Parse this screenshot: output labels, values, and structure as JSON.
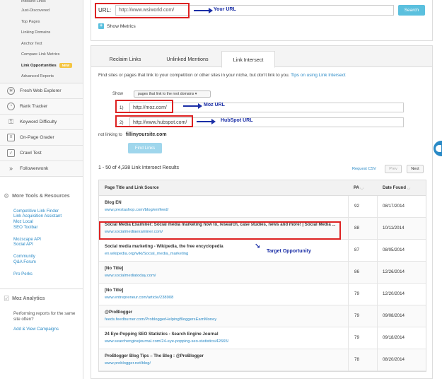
{
  "sidebar": {
    "subnav": [
      {
        "label": "Inbound Links"
      },
      {
        "label": "Just-Discovered"
      },
      {
        "label": "Top Pages"
      },
      {
        "label": "Linking Domains"
      },
      {
        "label": "Anchor Text"
      },
      {
        "label": "Compare Link Metrics"
      },
      {
        "label": "Link Opportunities",
        "badge": "NEW"
      },
      {
        "label": "Advanced Reports"
      }
    ],
    "tools": [
      {
        "label": "Fresh Web Explorer",
        "icon": "compass-icon"
      },
      {
        "label": "Rank Tracker",
        "icon": "gauge-icon"
      },
      {
        "label": "Keyword Difficulty",
        "icon": "key-icon"
      },
      {
        "label": "On-Page Grader",
        "icon": "document-icon"
      },
      {
        "label": "Crawl Test",
        "icon": "checkbox-icon"
      },
      {
        "label": "Followerwonk",
        "icon": "chevrons-icon"
      }
    ],
    "more_tools_title": "More Tools & Resources",
    "more_tools_links": [
      "Competitive Link Finder",
      "Link Acquisition Assistant",
      "Moz Local",
      "SEO Toolbar"
    ],
    "api_links": [
      "Mozscape API",
      "Social API"
    ],
    "community_links": [
      "Community",
      "Q&A Forum"
    ],
    "perks_link": "Pro Perks",
    "analytics_title": "Moz Analytics",
    "analytics_text": "Performing reports for the same site often?",
    "analytics_link": "Add & View Campaigns"
  },
  "header": {
    "url_label": "URL:",
    "url_value": "http://www.wsiworld.com/",
    "search_label": "Search",
    "show_metrics": "Show Metrics"
  },
  "tabs": [
    {
      "label": "Reclaim Links"
    },
    {
      "label": "Unlinked Mentions"
    },
    {
      "label": "Link Intersect"
    }
  ],
  "intersect": {
    "description": "Find sites or pages that link to your competition or other sites in your niche, but don't link to you.",
    "tip": "Tips on using Link Intersect",
    "show_label": "Show",
    "show_select": "pages that link to the root domains",
    "domains": [
      {
        "num": "1)",
        "value": "http://moz.com/"
      },
      {
        "num": "2)",
        "value": "http://www.hubspot.com/"
      }
    ],
    "not_linking_label": "not linking to",
    "not_linking_value": "fillinyoursite.com",
    "find_button": "Find Links",
    "results_count": "1 - 50 of 4,338 Link Intersect Results",
    "request_csv": "Request CSV",
    "prev": "Prev",
    "next": "Next"
  },
  "table": {
    "headers": {
      "title": "Page Title and Link Source",
      "pa": "PA",
      "date": "Date Found"
    },
    "rows": [
      {
        "title": "Blog EN",
        "url": "www.prestashop.com/blog/en/feed/",
        "pa": "92",
        "date": "08/17/2014"
      },
      {
        "title": "Social Media Examiner: Social media marketing how to, research, case studies, news and more! | Social Media ...",
        "url": "www.socialmediaexaminer.com/",
        "pa": "88",
        "date": "10/11/2014"
      },
      {
        "title": "Social media marketing - Wikipedia, the free encyclopedia",
        "url": "en.wikipedia.org/wiki/Social_media_marketing",
        "pa": "87",
        "date": "08/05/2014"
      },
      {
        "title": "[No Title]",
        "url": "www.socialmediatoday.com/",
        "pa": "86",
        "date": "12/26/2014"
      },
      {
        "title": "[No Title]",
        "url": "www.entrepreneur.com/article/238908",
        "pa": "79",
        "date": "12/20/2014"
      },
      {
        "title": "@ProBlogger",
        "url": "feeds.feedburner.com/ProbloggerHelpingBloggersEarnMoney",
        "pa": "79",
        "date": "09/08/2014"
      },
      {
        "title": "24 Eye-Popping SEO Statistics - Search Engine Journal",
        "url": "www.searchenginejournal.com/24-eye-popping-seo-statistics/42665/",
        "pa": "79",
        "date": "09/18/2014"
      },
      {
        "title": "ProBlogger Blog Tips – The Blog : @ProBlogger",
        "url": "www.problogger.net/blog/",
        "pa": "78",
        "date": "08/20/2014"
      }
    ]
  },
  "annotations": {
    "your_url": "Your URL",
    "moz_url": "Moz URL",
    "hubspot_url": "HubSpot URL",
    "target": "Target Opportunity"
  },
  "colors": {
    "accent": "#5bc0de",
    "link": "#2a8ac6",
    "highlight": "#dd2222",
    "annotation": "#1a2ea6"
  }
}
